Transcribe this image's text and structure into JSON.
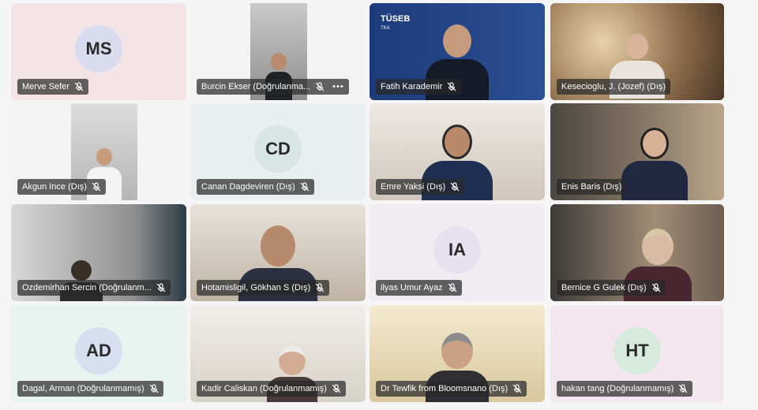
{
  "colors": {
    "background": "#f5f5f5",
    "label_bg": "rgba(40,40,40,0.72)",
    "active_border": "#6264a7"
  },
  "participants": [
    {
      "name": "Merve Sefer",
      "initials": "MS",
      "avatar_color": "#d9dcef",
      "tile_color": "#f4e4e6"
    },
    {
      "name": "Burcin Ekser (Doğrulanma...",
      "more": "•••"
    },
    {
      "name": "Fatih Karademir",
      "logo": "TÜSEB",
      "logo_small": "TKA"
    },
    {
      "name": "Kesecioglu, J. (Jozef) (Dış)"
    },
    {
      "name": "Akgun Ince (Dış)"
    },
    {
      "name": "Canan Dagdeviren (Dış)",
      "initials": "CD",
      "avatar_color": "#d7e6e4",
      "tile_color": "#e9eeee"
    },
    {
      "name": "Emre Yaksi (Dış)"
    },
    {
      "name": "Enis Baris (Dış)"
    },
    {
      "name": "Ozdemirhan Sercin (Doğrulanm..."
    },
    {
      "name": "Hotamisligil, Gökhan S (Dış)"
    },
    {
      "name": "ilyas Umur Ayaz",
      "initials": "IA",
      "avatar_color": "#e6e1ef",
      "tile_color": "#efedf1"
    },
    {
      "name": "Bernice G Gulek (Dış)"
    },
    {
      "name": "Dagal, Arman (Doğrulanmamış)",
      "initials": "AD",
      "avatar_color": "#d6dff0",
      "tile_color": "#e8f3ef"
    },
    {
      "name": "Kadir Caliskan (Doğrulanmamış)"
    },
    {
      "name": "Dr Tewfik from Bloomsnano (Dış)"
    },
    {
      "name": "hakan tang (Doğrulanmamış)",
      "initials": "HT",
      "avatar_color": "#d6eadd",
      "tile_color": "#f4e6ee"
    }
  ]
}
